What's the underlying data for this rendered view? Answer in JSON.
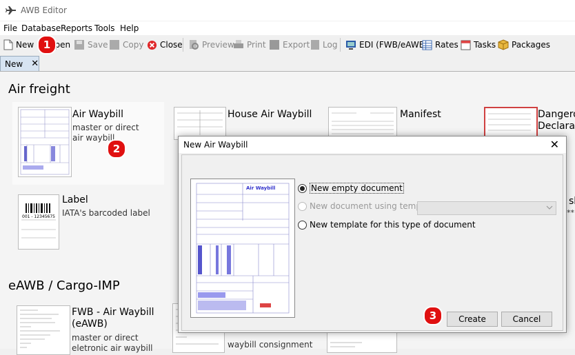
{
  "window": {
    "title": "AWB Editor"
  },
  "menu": [
    "File",
    "Database",
    "Reports",
    "Tools",
    "Help"
  ],
  "toolbar": {
    "new": "New",
    "open": "Open",
    "save": "Save",
    "copy": "Copy",
    "close": "Close",
    "preview": "Preview",
    "print": "Print",
    "export": "Export",
    "log": "Log",
    "edi": "EDI (FWB/eAWB)",
    "rates": "Rates",
    "tasks": "Tasks",
    "packages": "Packages"
  },
  "tabs": [
    {
      "label": "New"
    }
  ],
  "sections": {
    "air_freight": "Air freight",
    "eawb": "eAWB / Cargo-IMP"
  },
  "items": {
    "air_waybill": {
      "title": "Air Waybill",
      "desc": "master or direct air waybill"
    },
    "house_air_waybill": {
      "title": "House Air Waybill"
    },
    "manifest": {
      "title": "Manifest"
    },
    "dangerous": {
      "title": "Dangero",
      "title2": "Declaratio"
    },
    "label": {
      "title": "Label",
      "desc": "IATA's barcoded label",
      "barcode": "001 - 12345675"
    },
    "fwb": {
      "title": "FWB - Air Waybill (eAWB)",
      "desc": "master or direct eletronic air waybill"
    },
    "waybill_consignment": {
      "desc": "waybill consignment"
    },
    "partial_right": {
      "text1": "sl",
      "text2": "**"
    }
  },
  "badges": [
    "1",
    "2",
    "3"
  ],
  "dialog": {
    "title": "New Air Waybill",
    "preview_title": "Air Waybill",
    "options": [
      {
        "label": "New empty document",
        "selected": true,
        "enabled": true
      },
      {
        "label": "New document using template",
        "selected": false,
        "enabled": false
      },
      {
        "label": "New template for this type of document",
        "selected": false,
        "enabled": true
      }
    ],
    "buttons": {
      "create": "Create",
      "cancel": "Cancel"
    }
  },
  "colors": {
    "badge": "#e01010",
    "tab": "#d7e4f2",
    "form_blue": "#3333cc"
  }
}
